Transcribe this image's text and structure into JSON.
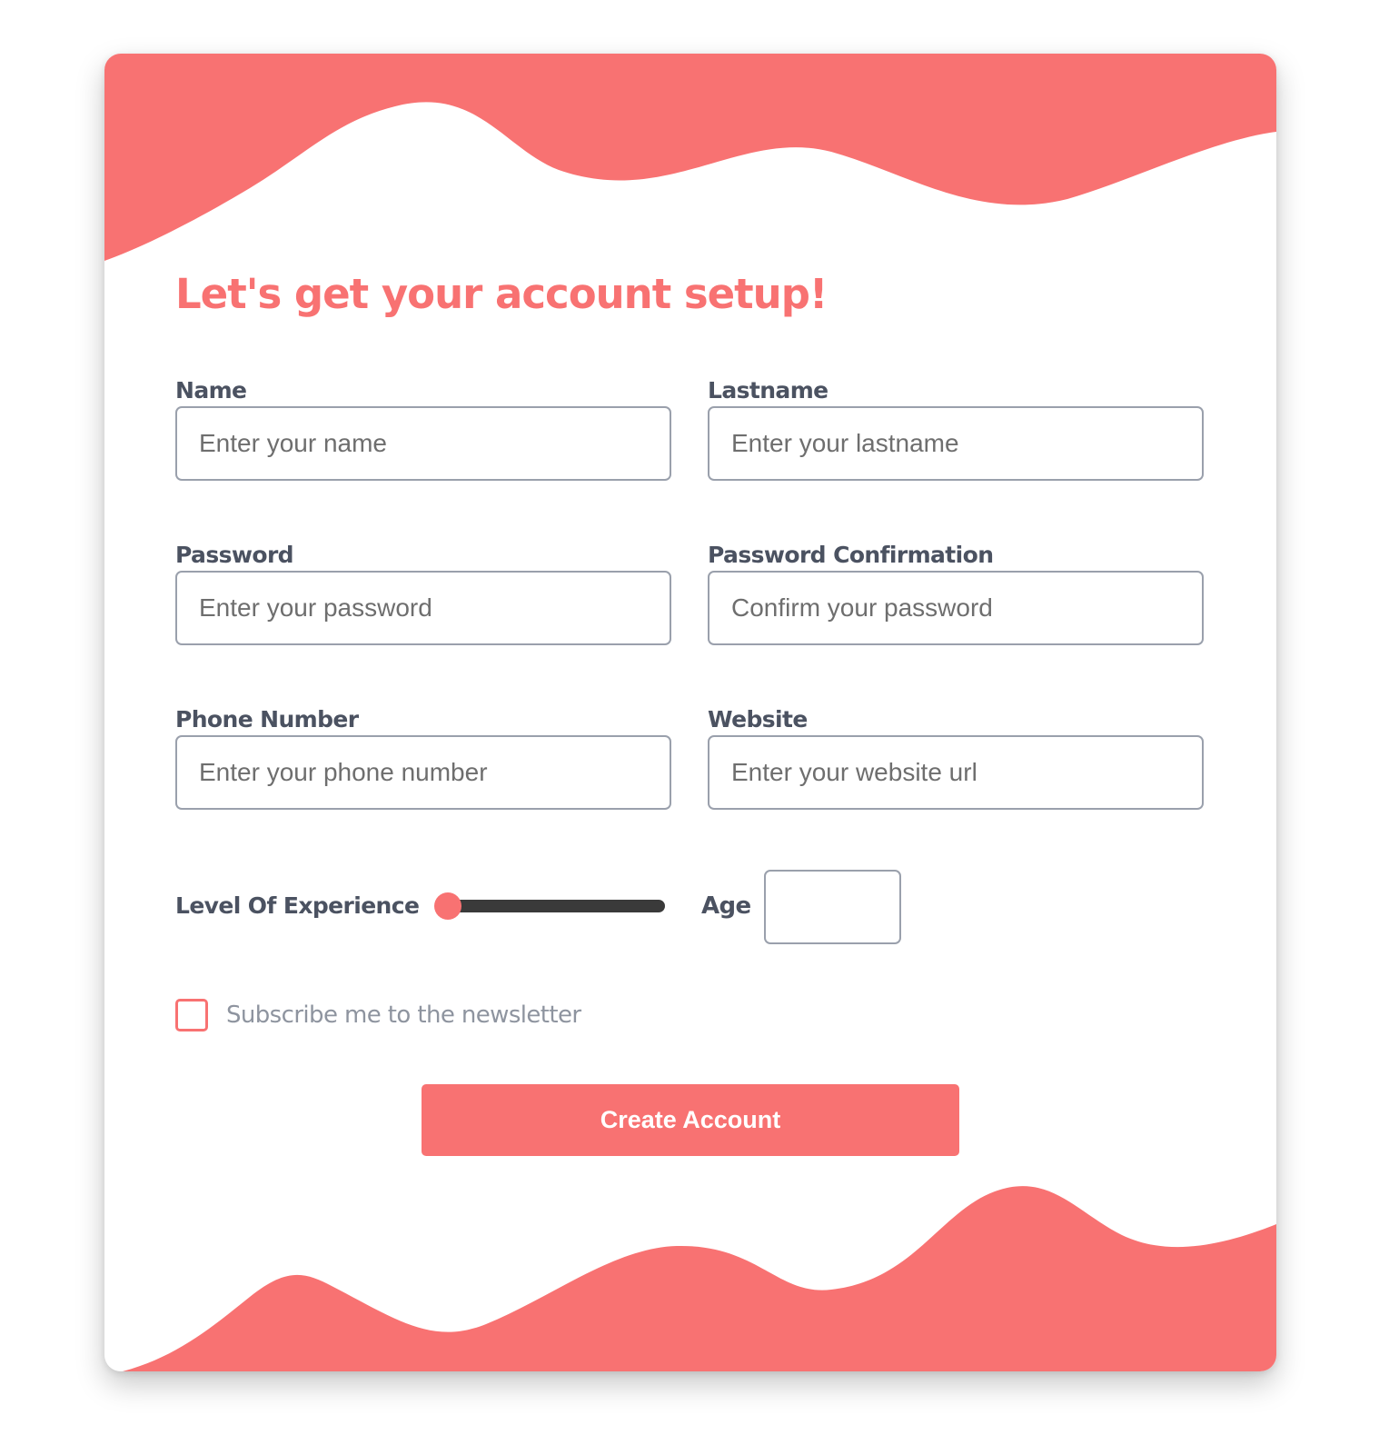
{
  "form": {
    "title": "Let's get your account setup!",
    "fields": {
      "name": {
        "label": "Name",
        "placeholder": "Enter your name",
        "value": ""
      },
      "lastname": {
        "label": "Lastname",
        "placeholder": "Enter your lastname",
        "value": ""
      },
      "password": {
        "label": "Password",
        "placeholder": "Enter your password",
        "value": ""
      },
      "password_confirmation": {
        "label": "Password Confirmation",
        "placeholder": "Confirm your password",
        "value": ""
      },
      "phone": {
        "label": "Phone Number",
        "placeholder": "Enter your phone number",
        "value": ""
      },
      "website": {
        "label": "Website",
        "placeholder": "Enter your website url",
        "value": ""
      }
    },
    "experience": {
      "label": "Level Of Experience",
      "level": 0
    },
    "age": {
      "label": "Age",
      "value": ""
    },
    "newsletter": {
      "label": "Subscribe me to the newsletter",
      "checked": false
    },
    "submit_label": "Create Account"
  },
  "colors": {
    "accent": "#f87272",
    "label": "#4b5261",
    "muted_text": "#8e949f",
    "input_border": "#9aa0ac",
    "slider_track": "#3a3a3a",
    "background": "#ffffff"
  }
}
